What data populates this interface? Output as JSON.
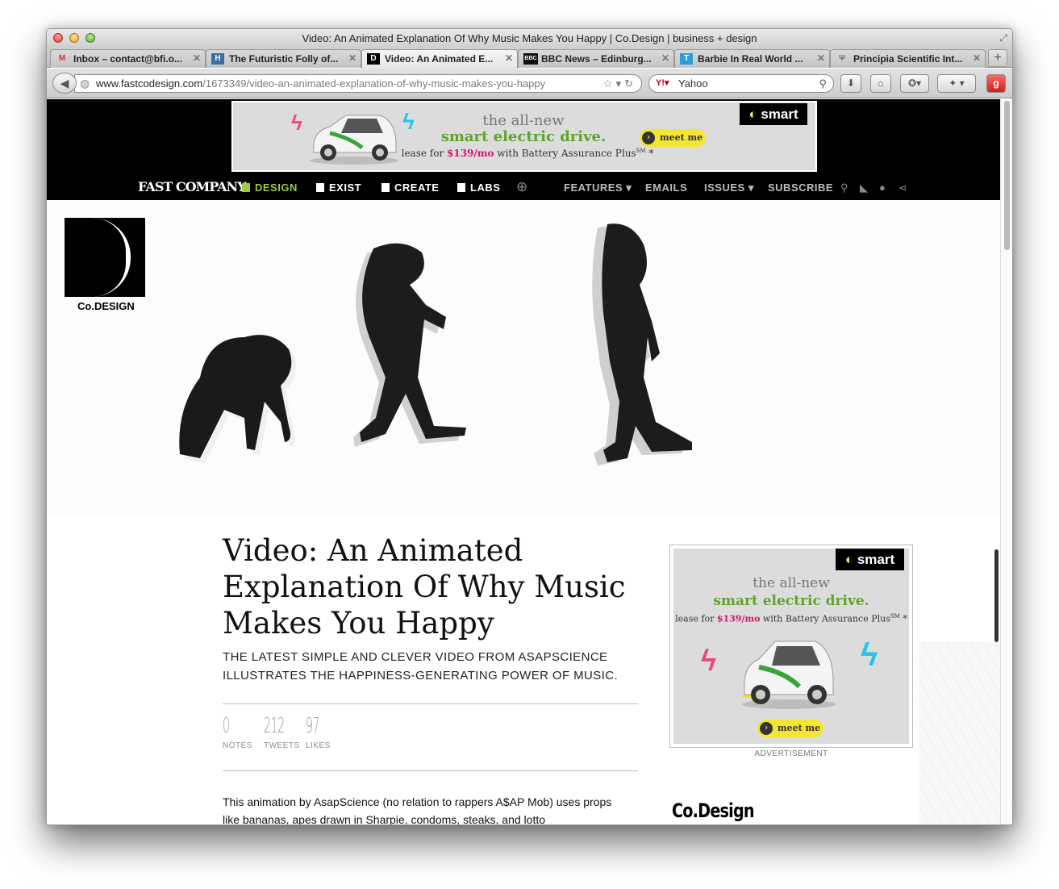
{
  "window": {
    "title": "Video: An Animated Explanation Of Why Music Makes You Happy | Co.Design | business + design"
  },
  "tabs": [
    {
      "label": "Inbox – contact@bfi.o...",
      "icon": "gmail-icon",
      "favicon_text": "M"
    },
    {
      "label": "The Futuristic Folly of...",
      "icon": "site-icon",
      "favicon_text": "H"
    },
    {
      "label": "Video: An Animated E...",
      "icon": "codesign-icon",
      "favicon_text": "D"
    },
    {
      "label": "BBC News – Edinburg...",
      "icon": "bbc-icon",
      "favicon_text": "BBC"
    },
    {
      "label": "Barbie In Real World ...",
      "icon": "t-icon",
      "favicon_text": "T"
    },
    {
      "label": "Principia Scientific Int...",
      "icon": "trident-icon",
      "favicon_text": "Ψ"
    }
  ],
  "toolbar": {
    "url_host": "www.fastcodesign.com",
    "url_path": "/1673349/video-an-animated-explanation-of-why-music-makes-you-happy",
    "search_engine": "Yahoo"
  },
  "ad": {
    "line1": "the all-new",
    "line2": "smart electric drive.",
    "lease_prefix": "lease for ",
    "price": "$139/mo",
    "lease_suffix": " with Battery Assurance Plus",
    "sm": "SM",
    "asterisk": " *",
    "brand": "smart",
    "cta": "meet me",
    "caption": "ADVERTISEMENT"
  },
  "nav": {
    "logo": "FAST COMPANY",
    "design": "DESIGN",
    "exist": "EXIST",
    "create": "CREATE",
    "labs": "LABS",
    "features": "FEATURES",
    "emails": "EMAILS",
    "issues": "ISSUES",
    "subscribe": "SUBSCRIBE"
  },
  "brand": {
    "codesign_label": "Co.DESIGN",
    "codesign_small": "Co.Design"
  },
  "article": {
    "headline": "Video: An Animated Explanation Of Why Music Makes You Happy",
    "dek": "THE LATEST SIMPLE AND CLEVER VIDEO FROM ASAPSCIENCE ILLUSTRATES THE HAPPINESS-GENERATING POWER OF MUSIC.",
    "stats": [
      {
        "value": "0",
        "label": "NOTES"
      },
      {
        "value": "212",
        "label": "TWEETS"
      },
      {
        "value": "97",
        "label": "LIKES"
      }
    ],
    "body": "This animation by AsapScience (no relation to rappers A$AP Mob) uses props like bananas, apes drawn in Sharpie, condoms, steaks, and lotto"
  },
  "colors": {
    "design_green": "#9ccb3b",
    "ad_green": "#61a42c",
    "ad_pink": "#d0186e",
    "ad_yellow": "#f5e533"
  }
}
